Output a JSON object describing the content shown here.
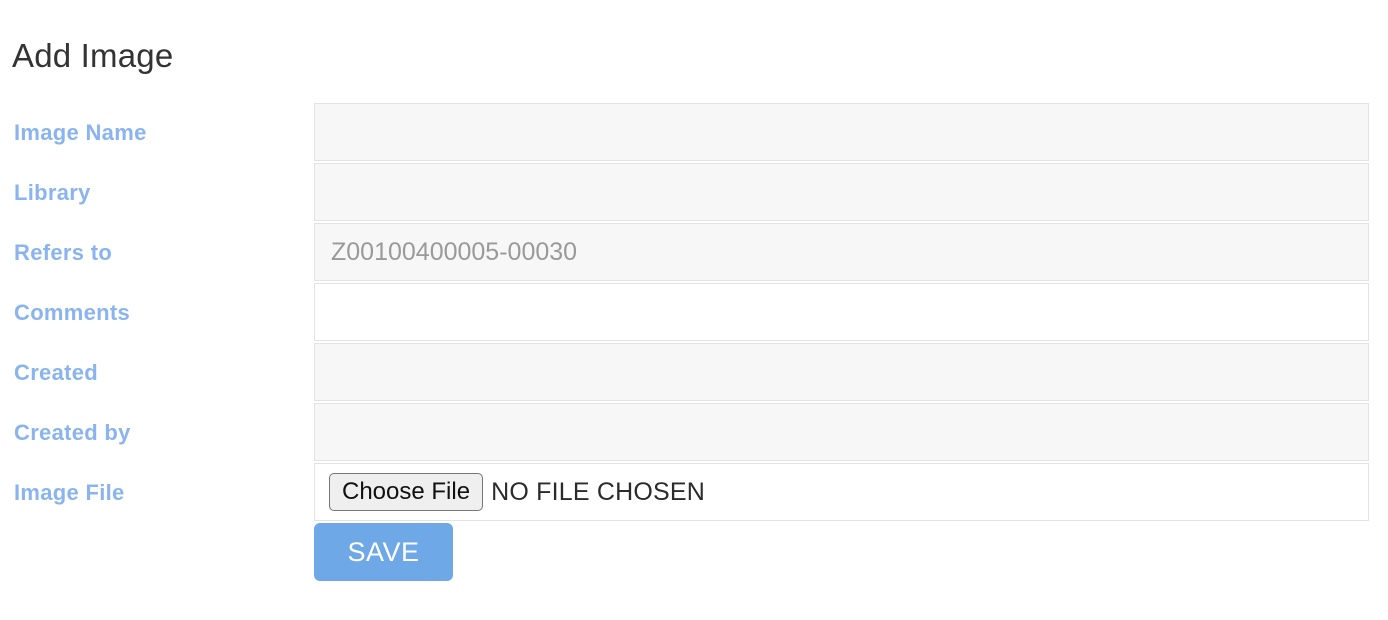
{
  "page": {
    "title": "Add Image"
  },
  "form": {
    "rows": [
      {
        "label": "Image Name",
        "value": "",
        "placeholder": "",
        "state": "disabled",
        "type": "text"
      },
      {
        "label": "Library",
        "value": "",
        "placeholder": "",
        "state": "disabled",
        "type": "text"
      },
      {
        "label": "Refers to",
        "value": "Z00100400005-00030",
        "placeholder": "",
        "state": "disabled",
        "type": "text"
      },
      {
        "label": "Comments",
        "value": "",
        "placeholder": "",
        "state": "editable",
        "type": "text"
      },
      {
        "label": "Created",
        "value": "",
        "placeholder": "",
        "state": "disabled",
        "type": "text"
      },
      {
        "label": "Created by",
        "value": "",
        "placeholder": "",
        "state": "disabled",
        "type": "text"
      },
      {
        "label": "Image File",
        "value": "",
        "placeholder": "",
        "state": "editable",
        "type": "file"
      }
    ],
    "file_input": {
      "button_label": "Choose File",
      "status_text": "NO FILE CHOSEN"
    },
    "save_label": "SAVE"
  },
  "colors": {
    "label_blue": "#8ab4f0",
    "save_blue": "#6fa8e6",
    "title_text": "#333333",
    "field_disabled_bg": "#f7f7f7",
    "field_border": "#e3e3e3",
    "field_value_text": "#9a9a9a"
  }
}
